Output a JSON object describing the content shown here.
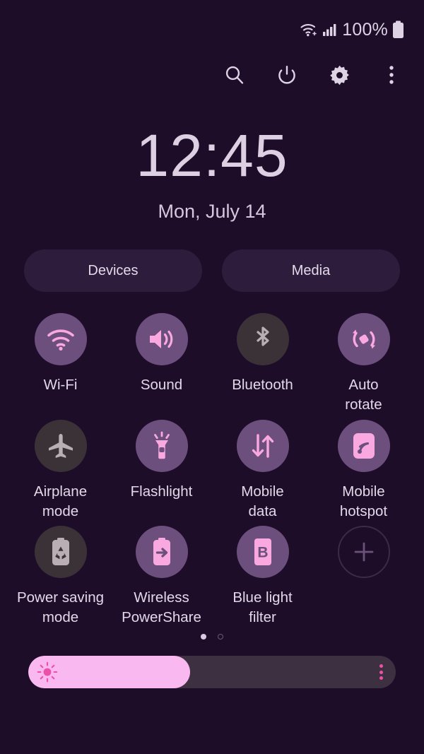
{
  "statusbar": {
    "wifi_icon": "wifi-icon",
    "signal_icon": "cellular-signal-icon",
    "battery_text": "100%",
    "battery_icon": "battery-full-icon"
  },
  "actions": [
    {
      "name": "search-icon",
      "label": "Search"
    },
    {
      "name": "power-icon",
      "label": "Power"
    },
    {
      "name": "gear-icon",
      "label": "Settings"
    },
    {
      "name": "more-options-icon",
      "label": "More options"
    }
  ],
  "clock": {
    "time": "12:45",
    "date": "Mon, July 14"
  },
  "shortcuts": {
    "devices_label": "Devices",
    "media_label": "Media"
  },
  "toggles": [
    {
      "label": "Wi-Fi",
      "icon": "wifi-icon",
      "state": "on"
    },
    {
      "label": "Sound",
      "icon": "sound-icon",
      "state": "on"
    },
    {
      "label": "Bluetooth",
      "icon": "bluetooth-icon",
      "state": "off"
    },
    {
      "label": "Auto\nrotate",
      "icon": "auto-rotate-icon",
      "state": "on"
    },
    {
      "label": "Airplane\nmode",
      "icon": "airplane-icon",
      "state": "off"
    },
    {
      "label": "Flashlight",
      "icon": "flashlight-icon",
      "state": "on"
    },
    {
      "label": "Mobile\ndata",
      "icon": "mobile-data-icon",
      "state": "on"
    },
    {
      "label": "Mobile\nhotspot",
      "icon": "mobile-hotspot-icon",
      "state": "on"
    },
    {
      "label": "Power saving\nmode",
      "icon": "power-saving-icon",
      "state": "off"
    },
    {
      "label": "Wireless\nPowerShare",
      "icon": "wireless-powershare-icon",
      "state": "on"
    },
    {
      "label": "Blue light\nfilter",
      "icon": "blue-light-filter-icon",
      "state": "on"
    },
    {
      "label": "",
      "icon": "add-icon",
      "state": "add"
    }
  ],
  "pager": {
    "total": 2,
    "active": 1
  },
  "brightness": {
    "percent": 44,
    "icon": "brightness-sun-icon",
    "menu_icon": "brightness-options-icon"
  },
  "colors": {
    "background": "#1d0d29",
    "tile_on": "#6d4f7e",
    "tile_off": "#3b3238",
    "accent_pink": "#f9a8e0",
    "slider_fill": "#f9b8ef",
    "text": "#e2d8e8"
  }
}
